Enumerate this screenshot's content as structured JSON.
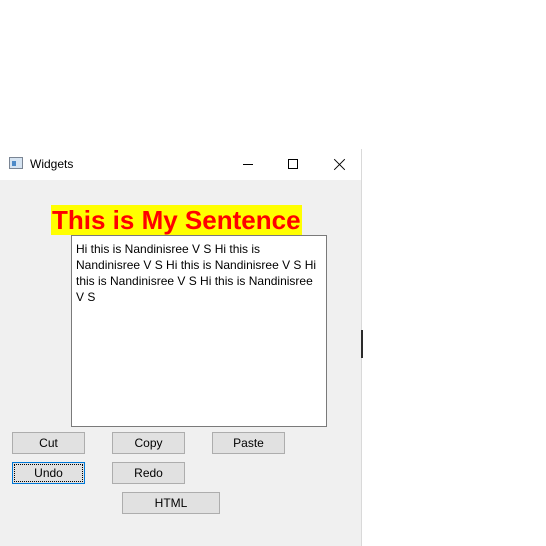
{
  "window": {
    "title": "Widgets"
  },
  "headline": {
    "text": "This is My Sentence",
    "color": "#ff0000",
    "background": "#ffff00"
  },
  "editor": {
    "text": "Hi this is Nandinisree V S Hi this is Nandinisree V S Hi this is Nandinisree V S Hi this is Nandinisree V S Hi this is Nandinisree V S"
  },
  "buttons": {
    "cut": "Cut",
    "copy": "Copy",
    "paste": "Paste",
    "undo": "Undo",
    "redo": "Redo",
    "html": "HTML"
  }
}
